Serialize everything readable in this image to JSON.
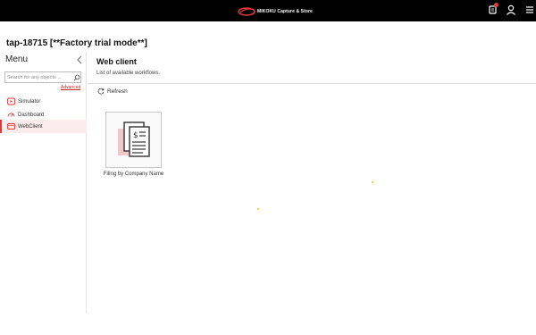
{
  "topbar": {
    "brand_text": "MIKOKU Capture & Store",
    "icons": [
      "notification-icon",
      "user-icon",
      "menu-icon"
    ],
    "notification_badge_color": "#e53935"
  },
  "app": {
    "title": "tap-18715 [**Factory trial mode**]"
  },
  "sidebar": {
    "title": "Menu",
    "search": {
      "placeholder": "Search for any objects ...",
      "value": ""
    },
    "advanced_link": "Advanced",
    "items": [
      {
        "label": "Simulator",
        "icon": "play-icon",
        "active": false
      },
      {
        "label": "Dashboard",
        "icon": "dashboard-icon",
        "active": false
      },
      {
        "label": "WebClient",
        "icon": "web-icon",
        "active": true
      }
    ]
  },
  "main": {
    "title": "Web client",
    "subtitle": "List of available workflows.",
    "refresh_label": "Refresh",
    "workflows": [
      {
        "label": "Filing by Company Name",
        "icon": "invoice-document-icon"
      }
    ]
  },
  "colors": {
    "accent": "#e53935",
    "topbar_bg": "#000000",
    "active_item_bg": "#fdecee"
  }
}
